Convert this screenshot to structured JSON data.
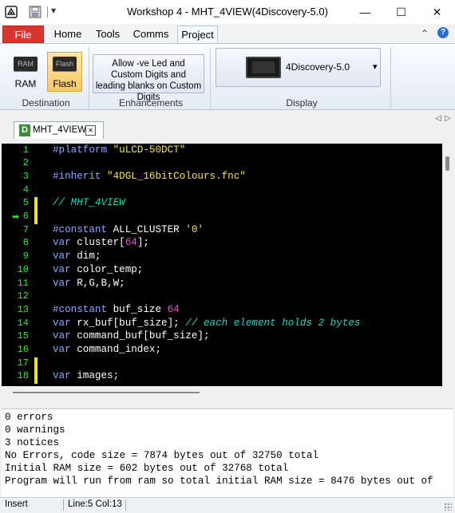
{
  "window": {
    "title": "Workshop 4 - MHT_4VIEW(4Discovery-5.0)",
    "minimize_glyph": "—",
    "maximize_glyph": "☐",
    "close_glyph": "✕",
    "dropdown_glyph": "▾"
  },
  "ribbon_tabs": [
    "File",
    "Home",
    "Tools",
    "Comms",
    "Project"
  ],
  "ribbon": {
    "ram_chip": "RAM",
    "ram_label": "RAM",
    "flash_chip": "Flash",
    "flash_label": "Flash",
    "destination_label": "Destination",
    "enhancement_button": "Allow -ve Led and Custom Digits and leading blanks on Custom Digits",
    "enhancements_label": "Enhancements",
    "display_selector": "4Discovery-5.0",
    "display_label": "Display",
    "help_glyph": "?",
    "collapse_glyph": "⌃"
  },
  "doc_tab": {
    "icon_letter": "D",
    "name": "MHT_4VIEW",
    "close_glyph": "✕",
    "prev_glyph": "◁",
    "next_glyph": "▷"
  },
  "editor": {
    "line_numbers": [
      "1",
      "2",
      "3",
      "4",
      "5",
      "6",
      "7",
      "8",
      "9",
      "10",
      "11",
      "12",
      "13",
      "14",
      "15",
      "16",
      "17",
      "18"
    ],
    "current_line_marker": "➡",
    "lines": [
      [
        {
          "t": "#platform ",
          "c": "kw"
        },
        {
          "t": "\"uLCD-50DCT\"",
          "c": "str"
        }
      ],
      [],
      [
        {
          "t": "#inherit ",
          "c": "kw"
        },
        {
          "t": "\"4DGL_16bitColours.fnc\"",
          "c": "str"
        }
      ],
      [],
      [
        {
          "t": "// MHT_4VIEW",
          "c": "cm"
        }
      ],
      [],
      [
        {
          "t": "#constant ",
          "c": "kw"
        },
        {
          "t": "ALL_CLUSTER ",
          "c": "p"
        },
        {
          "t": "'0'",
          "c": "str"
        }
      ],
      [
        {
          "t": "var ",
          "c": "kw"
        },
        {
          "t": "cluster[",
          "c": "p"
        },
        {
          "t": "64",
          "c": "num"
        },
        {
          "t": "];",
          "c": "p"
        }
      ],
      [
        {
          "t": "var ",
          "c": "kw"
        },
        {
          "t": "dim;",
          "c": "p"
        }
      ],
      [
        {
          "t": "var ",
          "c": "kw"
        },
        {
          "t": "color_temp;",
          "c": "p"
        }
      ],
      [
        {
          "t": "var ",
          "c": "kw"
        },
        {
          "t": "R,G,B,W;",
          "c": "p"
        }
      ],
      [],
      [
        {
          "t": "#constant ",
          "c": "kw"
        },
        {
          "t": "buf_size ",
          "c": "p"
        },
        {
          "t": "64",
          "c": "num"
        }
      ],
      [
        {
          "t": "var ",
          "c": "kw"
        },
        {
          "t": "rx_buf[buf_size]; ",
          "c": "p"
        },
        {
          "t": "// each element holds 2 bytes",
          "c": "cm"
        }
      ],
      [
        {
          "t": "var ",
          "c": "kw"
        },
        {
          "t": "command_buf[buf_size];",
          "c": "p"
        }
      ],
      [
        {
          "t": "var ",
          "c": "kw"
        },
        {
          "t": "command_index;",
          "c": "p"
        }
      ],
      [],
      [
        {
          "t": "var ",
          "c": "kw"
        },
        {
          "t": "images;",
          "c": "p"
        }
      ]
    ]
  },
  "output_lines": [
    "0 errors",
    "0 warnings",
    "3 notices",
    "No Errors, code size = 7874 bytes out of 32750 total",
    "Initial RAM size = 602 bytes out of 32768 total",
    "Program will run from ram so total initial RAM size = 8476 bytes out of"
  ],
  "status": {
    "mode": "Insert",
    "position": "Line:5 Col:13"
  },
  "colors": {
    "file_tab": "#d9352f",
    "line_number": "#2ee62e",
    "keyword": "#8fa8ff",
    "string": "#f7e05a",
    "number": "#e94cd9",
    "comment": "#18d6c0"
  }
}
